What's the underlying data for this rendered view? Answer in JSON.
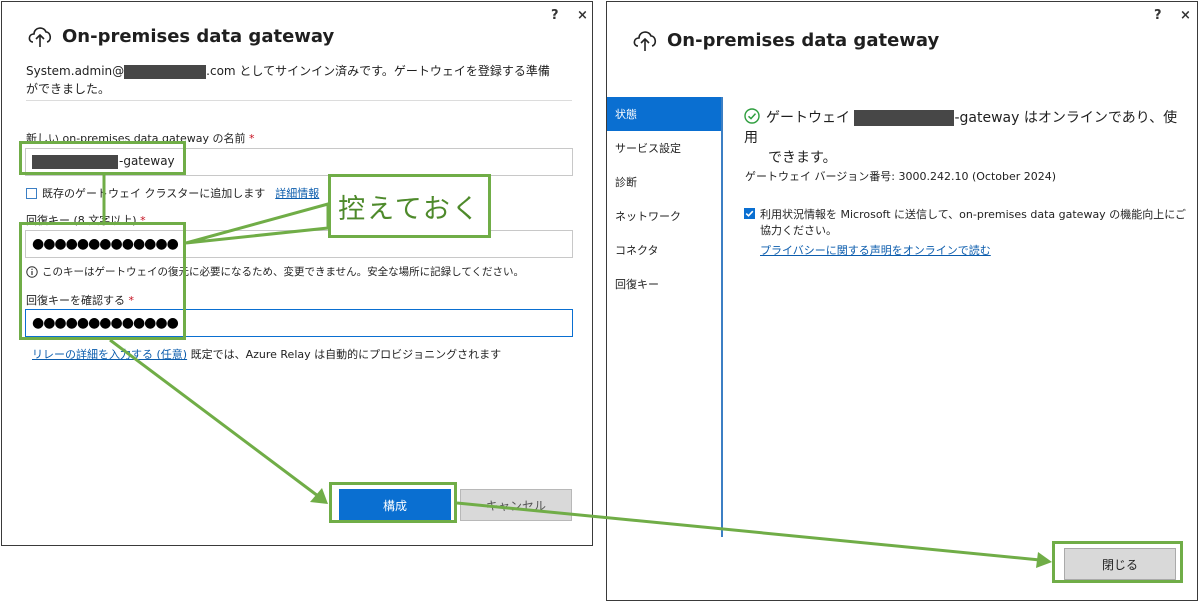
{
  "left_dialog": {
    "help": "?",
    "close": "×",
    "title": "On-premises data gateway",
    "signin_prefix": "System.admin@",
    "signin_suffix": ".com としてサインイン済みです。ゲートウェイを登録する準備",
    "signin_line2": "ができました。",
    "name_label": "新しい on-premises data gateway の名前",
    "required_mark": "*",
    "name_suffix": "-gateway",
    "cluster_label": "既存のゲートウェイ クラスターに追加します",
    "details_link": "詳細情報",
    "recovery_label": "回復キー (8 文字以上)",
    "recovery_value": "●●●●●●●●●●●●●",
    "recovery_note": "このキーはゲートウェイの復元に必要になるため、変更できません。安全な場所に記録してください。",
    "confirm_label": "回復キーを確認する",
    "confirm_value": "●●●●●●●●●●●●●",
    "relay_link": "リレーの詳細を入力する (任意)",
    "relay_text": "既定では、Azure Relay は自動的にプロビジョニングされます",
    "configure_button": "構成",
    "cancel_button": "キャンセル"
  },
  "callout": "控えておく",
  "right_dialog": {
    "help": "?",
    "close": "×",
    "title": "On-premises data gateway",
    "nav": [
      "状態",
      "サービス設定",
      "診断",
      "ネットワーク",
      "コネクタ",
      "回復キー"
    ],
    "status_prefix": "ゲートウェイ",
    "status_suffix": "-gateway はオンラインであり、使用",
    "status_line2": "できます。",
    "version": "ゲートウェイ バージョン番号: 3000.242.10 (October 2024)",
    "telemetry_line1": "利用状況情報を Microsoft に送信して、on-premises data gateway の機能向上にご",
    "telemetry_line2": "協力ください。",
    "privacy_link": "プライバシーに関する声明をオンラインで読む",
    "close_button": "閉じる"
  },
  "colors": {
    "accent": "#0a6fd1",
    "annotation": "#70ad47",
    "online_check": "#2e9e3e"
  }
}
